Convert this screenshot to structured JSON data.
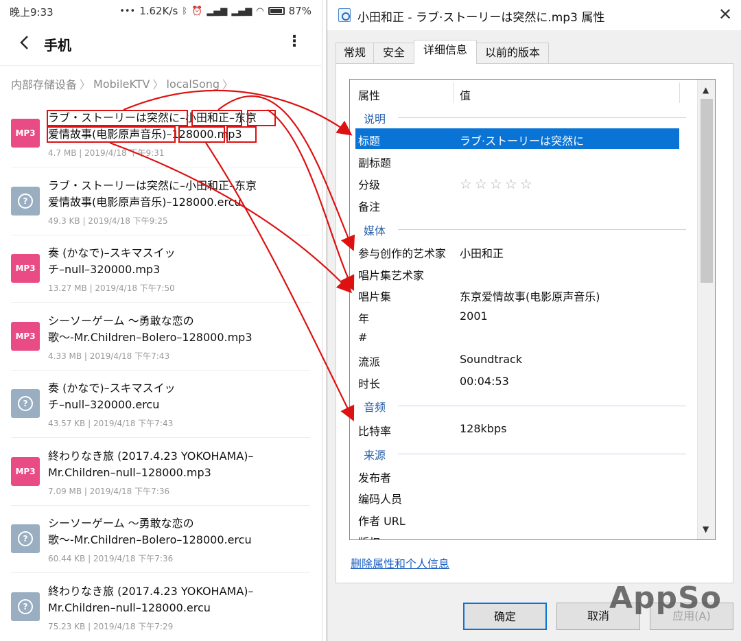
{
  "phone": {
    "status": {
      "time": "晚上9:33",
      "dots": "•••",
      "speed": "1.62K/s",
      "battery": "87%"
    },
    "app_title": "手机",
    "breadcrumb": [
      "内部存储设备",
      "MobileKTV",
      "localSong"
    ],
    "files": [
      {
        "line1": "ラブ・ストーリーは突然に–小田和正–东京",
        "line2": "爱情故事(电影原声音乐)–128000.mp3",
        "meta": "4.7 MB  |  2019/4/18 下午9:31",
        "type": "MP3"
      },
      {
        "line1": "ラブ・ストーリーは突然に–小田和正–东京",
        "line2": "爱情故事(电影原声音乐)–128000.ercu",
        "meta": "49.3 KB  |  2019/4/18 下午9:25",
        "type": "?"
      },
      {
        "line1": "奏 (かなで)–スキマスイッ",
        "line2": "チ–null–320000.mp3",
        "meta": "13.27 MB  |  2019/4/18 下午7:50",
        "type": "MP3"
      },
      {
        "line1": "シーソーゲーム 〜勇敢な恋の",
        "line2": "歌〜-Mr.Children–Bolero–128000.mp3",
        "meta": "4.33 MB  |  2019/4/18 下午7:43",
        "type": "MP3"
      },
      {
        "line1": "奏 (かなで)–スキマスイッ",
        "line2": "チ–null–320000.ercu",
        "meta": "43.57 KB  |  2019/4/18 下午7:43",
        "type": "?"
      },
      {
        "line1": "終わりなき旅 (2017.4.23 YOKOHAMA)–",
        "line2": "Mr.Children–null–128000.mp3",
        "meta": "7.09 MB  |  2019/4/18 下午7:36",
        "type": "MP3"
      },
      {
        "line1": "シーソーゲーム 〜勇敢な恋の",
        "line2": "歌〜-Mr.Children–Bolero–128000.ercu",
        "meta": "60.44 KB  |  2019/4/18 下午7:36",
        "type": "?"
      },
      {
        "line1": "終わりなき旅 (2017.4.23 YOKOHAMA)–",
        "line2": "Mr.Children–null–128000.ercu",
        "meta": "75.23 KB  |  2019/4/18 下午7:29",
        "type": "?"
      }
    ]
  },
  "dialog": {
    "title": "小田和正 - ラブ·ストーリーは突然に.mp3 属性",
    "tabs": [
      "常规",
      "安全",
      "详细信息",
      "以前的版本"
    ],
    "columns": {
      "property": "属性",
      "value": "值"
    },
    "groups": {
      "description": "说明",
      "media": "媒体",
      "audio": "音频",
      "origin": "来源"
    },
    "rows": {
      "title": {
        "k": "标题",
        "v": "ラブ·ストーリーは突然に"
      },
      "subtitle": {
        "k": "副标题",
        "v": ""
      },
      "rating": {
        "k": "分级",
        "v": "☆☆☆☆☆"
      },
      "comments": {
        "k": "备注",
        "v": ""
      },
      "contributing_artists": {
        "k": "参与创作的艺术家",
        "v": "小田和正"
      },
      "album_artist": {
        "k": "唱片集艺术家",
        "v": ""
      },
      "album": {
        "k": "唱片集",
        "v": "东京爱情故事(电影原声音乐)"
      },
      "year": {
        "k": "年",
        "v": "2001"
      },
      "track": {
        "k": "#",
        "v": ""
      },
      "genre": {
        "k": "流派",
        "v": "Soundtrack"
      },
      "length": {
        "k": "时长",
        "v": "00:04:53"
      },
      "bitrate": {
        "k": "比特率",
        "v": "128kbps"
      },
      "publisher": {
        "k": "发布者",
        "v": ""
      },
      "encoded_by": {
        "k": "编码人员",
        "v": ""
      },
      "author_url": {
        "k": "作者 URL",
        "v": ""
      },
      "copyright": {
        "k": "版权",
        "v": ""
      }
    },
    "remove_link": "删除属性和个人信息",
    "buttons": {
      "ok": "确定",
      "cancel": "取消",
      "apply": "应用(A)"
    }
  },
  "watermark": "AppSo",
  "colors": {
    "mp3_icon": "#e94b84",
    "unknown_icon": "#9aaec2",
    "selection": "#0a74d6",
    "annotation": "#dd1111"
  }
}
